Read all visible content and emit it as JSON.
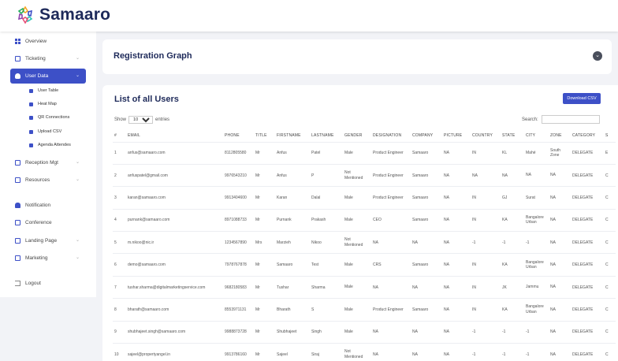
{
  "brand": {
    "name": "Samaaro"
  },
  "sidebar": {
    "items": [
      {
        "label": "Overview",
        "icon": "grid-icon"
      },
      {
        "label": "Ticketing",
        "icon": "ticket-icon",
        "chevron": "⌄"
      },
      {
        "label": "User Data",
        "icon": "users-icon",
        "chevron": "⌄"
      },
      {
        "label": "Reception Mgt",
        "icon": "reception-icon",
        "chevron": "⌄"
      },
      {
        "label": "Resources",
        "icon": "resources-icon",
        "chevron": "⌄"
      },
      {
        "label": "Notification",
        "icon": "bell-icon"
      },
      {
        "label": "Conference",
        "icon": "conference-icon"
      },
      {
        "label": "Landing Page",
        "icon": "landing-page-icon",
        "chevron": "⌄"
      },
      {
        "label": "Marketing",
        "icon": "mail-icon",
        "chevron": "⌄"
      },
      {
        "label": "Logout",
        "icon": "logout-icon"
      }
    ],
    "subitems": [
      {
        "label": "User Table"
      },
      {
        "label": "Heat Map"
      },
      {
        "label": "QR Connections"
      },
      {
        "label": "Upload CSV"
      },
      {
        "label": "Agenda Attendes"
      }
    ]
  },
  "registration": {
    "title": "Registration Graph"
  },
  "users": {
    "title": "List of all Users",
    "download_label": "Download CSV",
    "show_label": "Show",
    "show_value": "10",
    "entries_label": "entries",
    "search_label": "Search:",
    "columns": [
      "#",
      "EMAIL",
      "PHONE",
      "TITLE",
      "FIRSTNAME",
      "LASTNAME",
      "GENDER",
      "DESIGNATION",
      "COMPANY",
      "PICTURE",
      "COUNTRY",
      "STATE",
      "CITY",
      "ZONE",
      "CATEGORY",
      "S"
    ],
    "rows": [
      [
        "1",
        "anfus@samaaro.com",
        "8112805580",
        "Mr",
        "Anfus",
        "Patel",
        "Male",
        "Product Engineer",
        "Samaaro",
        "NA",
        "IN",
        "KL",
        "Mahé",
        "South Zone",
        "DELEGATE",
        "E"
      ],
      [
        "2",
        "anfuspatel@gmail.com",
        "9976543210",
        "Mr",
        "Anfus",
        "P",
        "Not Mentioned",
        "Product Engineer",
        "Samaaro",
        "NA",
        "NA",
        "NA",
        "NA",
        "NA",
        "DELEGATE",
        "C"
      ],
      [
        "3",
        "karan@samaaro.com",
        "9913404600",
        "Mr",
        "Karan",
        "Dalal",
        "Male",
        "Product Engineer",
        "Samaaro",
        "NA",
        "IN",
        "GJ",
        "Surat",
        "NA",
        "DELEGATE",
        "C"
      ],
      [
        "4",
        "purnank@samaaro.com",
        "8971088733",
        "Mr",
        "Purnank",
        "Prakash",
        "Male",
        "CEO",
        "Samaaro",
        "NA",
        "IN",
        "KA",
        "Bangalore Urban",
        "NA",
        "DELEGATE",
        "C"
      ],
      [
        "5",
        "m.nikoo@nic.ir",
        "1234567890",
        "Mrs",
        "Marzieh",
        "Nikoo",
        "Not Mentioned",
        "NA",
        "NA",
        "NA",
        "-1",
        "-1",
        "-1",
        "NA",
        "DELEGATE",
        "C"
      ],
      [
        "6",
        "demo@samaaro.com",
        "7978767878",
        "Mr",
        "Samaaro",
        "Test",
        "Male",
        "CRS",
        "Samaaro",
        "NA",
        "IN",
        "KA",
        "Bangalore Urban",
        "NA",
        "DELEGATE",
        "C"
      ],
      [
        "7",
        "tushar.sharma@digitalmarketingservice.com",
        "9682180583",
        "Mr",
        "Tushar",
        "Sharma",
        "Male",
        "NA",
        "NA",
        "NA",
        "IN",
        "JK",
        "Jammu",
        "NA",
        "DELEGATE",
        "C"
      ],
      [
        "8",
        "bharath@samaaro.com",
        "8553971131",
        "Mr",
        "Bharath",
        "S",
        "Male",
        "Product Engineer",
        "Samaaro",
        "NA",
        "IN",
        "KA",
        "Bangalore Urban",
        "NA",
        "DELEGATE",
        "C"
      ],
      [
        "9",
        "shubhajeet.singh@samaaro.com",
        "9988873728",
        "Mr",
        "Shubhajeet",
        "Singh",
        "Male",
        "NA",
        "NA",
        "NA",
        "-1",
        "-1",
        "-1",
        "NA",
        "DELEGATE",
        "C"
      ],
      [
        "10",
        "sajeel@propertyangel.in",
        "9913786160",
        "Mr",
        "Sajeel",
        "Siraj",
        "Not Mentioned",
        "NA",
        "NA",
        "NA",
        "-1",
        "-1",
        "-1",
        "NA",
        "DELEGATE",
        "C"
      ]
    ]
  },
  "colors": {
    "primary": "#3d50c7",
    "brand_text": "#1e2a5a",
    "background": "#f2f3f7"
  }
}
